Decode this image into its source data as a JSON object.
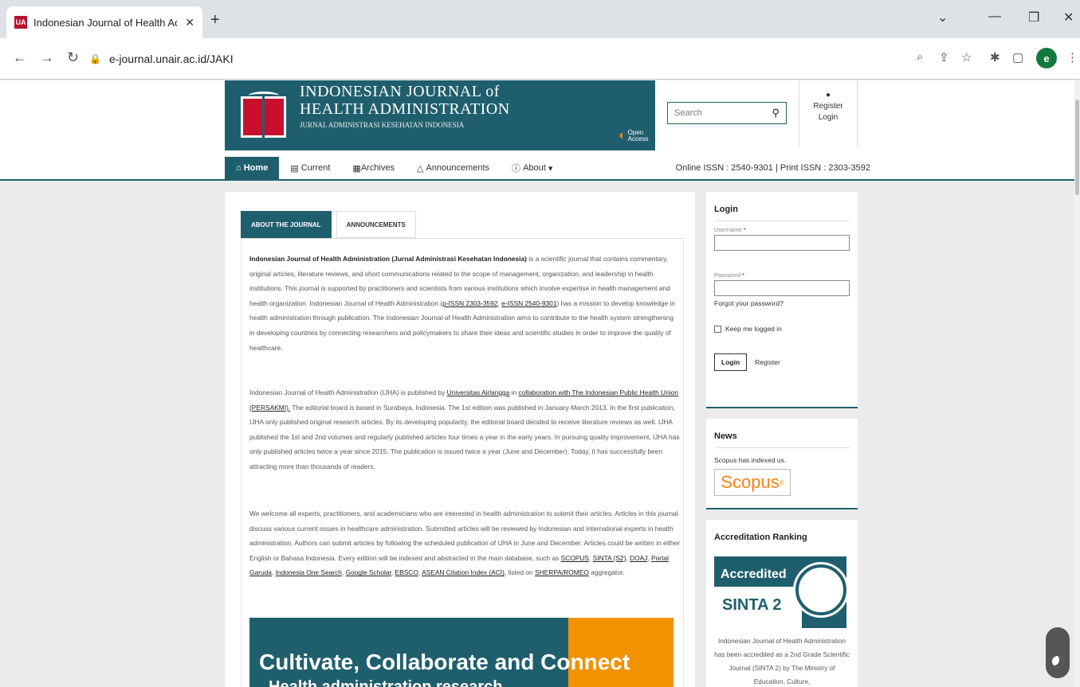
{
  "browser": {
    "tab_title": "Indonesian Journal of Health Ad",
    "tab_favicon": "UA",
    "url": "e-journal.unair.ac.id/JAKI",
    "avatar_letter": "e"
  },
  "header": {
    "title_line1": "INDONESIAN JOURNAL of",
    "title_line2": "HEALTH ADMINISTRATION",
    "title_line3": "JURNAL ADMINISTRASI KESEHATAN INDONESIA",
    "open_access": "Open Access",
    "search_placeholder": "Search",
    "register": "Register",
    "login": "Login"
  },
  "menu": {
    "items": [
      "Home",
      "Current",
      "Archives",
      "Announcements",
      "About"
    ],
    "issn": "Online ISSN : 2540-9301  |  Print ISSN : 2303-3592"
  },
  "main": {
    "tabs": [
      "ABOUT THE JOURNAL",
      "ANNOUNCEMENTS"
    ],
    "p1_bold": "Indonesian Journal of Health Administration (Jurnal Administrasi Kesehatan Indonesia)",
    "p1_a": " is a scientific journal that contains commentary, original articles, literature reviews, and short communications related to the scope of management, organization, and leadership in health institutions. This journal is supported by practitioners and scientists from various institutions which involve expertise in health management and health organization. Indonesian Journal of Health Administration (",
    "p1_link1": "p-ISSN 2303-3592",
    "p1_sep": ", ",
    "p1_link2": "e-ISSN 2540-9301",
    "p1_b": ") has a mission to develop knowledge in health administration through publication. The Indonesian Journal of Health Administration aims to contribute to the health system strengthening in developing countries by connecting researchers and policymakers to share their ideas and scientific studies in order to improve the quality of healthcare.",
    "p2_a": "Indonesian Journal of Health Administration (IJHA) is published by ",
    "p2_link1": "Universitas Airlangga",
    "p2_b": " in ",
    "p2_link2": "collaboration with The Indonesian Public Health Union (PERSAKMI).",
    "p2_c": " The editorial board is based in Surabaya, Indonesia. The 1st edition was published in January-March 2013. In the first publication, IJHA only published original research articles. By its developing popularity, the editorial board decided to receive literature reviews as well. IJHA published the 1st and 2nd volumes and regularly published articles four times a year in the early years. In pursuing quality improvement, IJHA has only published articles twice a year since 2015. The publication is issued twice a year (June and December). Today, it has successfully been attracting more than thousands of readers.",
    "p3_a": "We welcome all experts, practitioners, and academicians who are interested in health administration to submit their articles. Articles in this journal discuss various current issues in healthcare administration. Submitted articles will be reviewed by Indonesian and international experts in health administration. Authors can submit articles by following the scheduled publication of IJHA in June and December. Articles could be written in either English or Bahasa Indonesia. Every edition will be indexed and abstracted in the main database, such as ",
    "idx": [
      "SCOPUS",
      "SINTA (S2)",
      "DOAJ",
      "Portal Garuda",
      "Indonesia One Search",
      "Google Scholar",
      "EBSCO",
      "ASEAN Citation Index (ACI)"
    ],
    "p3_b": ", listed on ",
    "p3_link": "SHERPA/ROMEO",
    "p3_c": " aggregator.",
    "promo_line1a": "Cultivate, Collaborate and ",
    "promo_line1b": "Connect",
    "promo_line2": "Health administration research"
  },
  "sidebar": {
    "login_title": "Login",
    "username_label": "Username",
    "password_label": "Password",
    "required": "*",
    "forgot": "Forgot your password?",
    "keep": "Keep me logged in",
    "login_btn": "Login",
    "register_link": "Register",
    "news_title": "News",
    "news_text": "Scopus has indexed us.",
    "scopus": "Scopus",
    "accred_title": "Accreditation Ranking",
    "accredited": "Accredited",
    "sinta": "SINTA 2",
    "accred_text": "Indonesian Journal of Health Administration has been accredited as a 2nd Grade Scientific Journal (SINTA 2) by The Ministry of Education, Culture,"
  }
}
